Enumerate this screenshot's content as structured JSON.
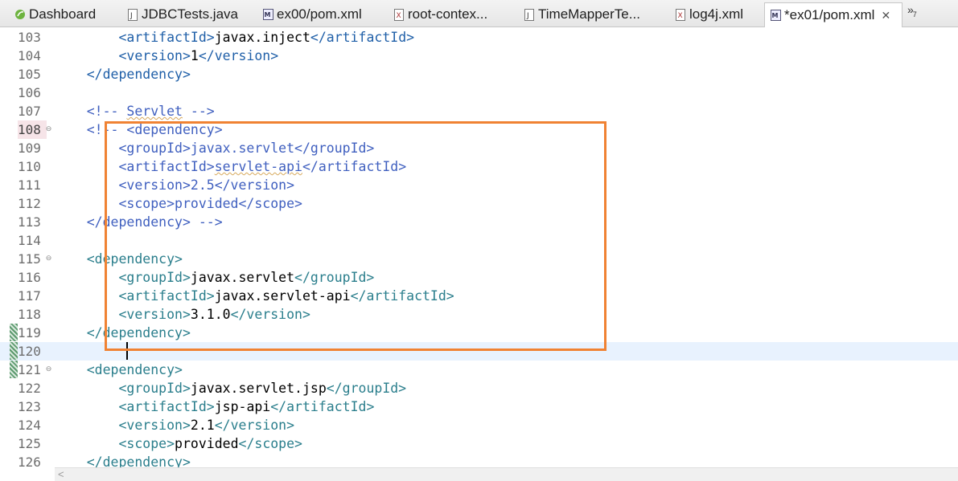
{
  "tabs": [
    {
      "label": "Dashboard",
      "icon": "spring-icon"
    },
    {
      "label": "JDBCTests.java",
      "icon": "java-file-icon"
    },
    {
      "label": "ex00/pom.xml",
      "icon": "maven-pom-icon"
    },
    {
      "label": "root-contex...",
      "icon": "xml-file-icon"
    },
    {
      "label": "TimeMapperTe...",
      "icon": "java-file-icon"
    },
    {
      "label": "log4j.xml",
      "icon": "xml-file-icon"
    },
    {
      "label": "*ex01/pom.xml",
      "icon": "maven-pom-icon",
      "active": true,
      "close": "✕"
    }
  ],
  "overflow": {
    "label": "»",
    "count": "7"
  },
  "editor": {
    "lines": [
      {
        "n": "103",
        "tokens": [
          [
            "        ",
            ""
          ],
          [
            "<artifactId>",
            "tag"
          ],
          [
            "javax.inject",
            "txt"
          ],
          [
            "</artifactId>",
            "tag"
          ]
        ]
      },
      {
        "n": "104",
        "tokens": [
          [
            "        ",
            ""
          ],
          [
            "<version>",
            "tag"
          ],
          [
            "1",
            "txt"
          ],
          [
            "</version>",
            "tag"
          ]
        ]
      },
      {
        "n": "105",
        "tokens": [
          [
            "    ",
            ""
          ],
          [
            "</dependency>",
            "tag"
          ]
        ]
      },
      {
        "n": "106",
        "tokens": []
      },
      {
        "n": "107",
        "tokens": [
          [
            "    ",
            ""
          ],
          [
            "<!-- ",
            "cmt"
          ],
          [
            "Servlet",
            "cmt sq"
          ],
          [
            " -->",
            "cmt"
          ]
        ]
      },
      {
        "n": "108",
        "diff": true,
        "fold": true,
        "tokens": [
          [
            "    ",
            ""
          ],
          [
            "<!-- <dependency>",
            "cmt"
          ]
        ]
      },
      {
        "n": "109",
        "tokens": [
          [
            "        ",
            ""
          ],
          [
            "<groupId>javax.servlet</groupId>",
            "cmt"
          ]
        ]
      },
      {
        "n": "110",
        "tokens": [
          [
            "        ",
            ""
          ],
          [
            "<artifactId>",
            "cmt"
          ],
          [
            "servlet-api",
            "cmt sq"
          ],
          [
            "</artifactId>",
            "cmt"
          ]
        ]
      },
      {
        "n": "111",
        "tokens": [
          [
            "        ",
            ""
          ],
          [
            "<version>2.5</version>",
            "cmt"
          ]
        ]
      },
      {
        "n": "112",
        "tokens": [
          [
            "        ",
            ""
          ],
          [
            "<scope>provided</scope>",
            "cmt"
          ]
        ]
      },
      {
        "n": "113",
        "tokens": [
          [
            "    ",
            ""
          ],
          [
            "</dependency> -->",
            "cmt"
          ]
        ]
      },
      {
        "n": "114",
        "tokens": []
      },
      {
        "n": "115",
        "fold": true,
        "tokens": [
          [
            "    ",
            ""
          ],
          [
            "<dependency>",
            "tag2"
          ]
        ]
      },
      {
        "n": "116",
        "tokens": [
          [
            "        ",
            ""
          ],
          [
            "<groupId>",
            "tag2"
          ],
          [
            "javax.servlet",
            "txt"
          ],
          [
            "</groupId>",
            "tag2"
          ]
        ]
      },
      {
        "n": "117",
        "tokens": [
          [
            "        ",
            ""
          ],
          [
            "<artifactId>",
            "tag2"
          ],
          [
            "javax.servlet-api",
            "txt"
          ],
          [
            "</artifactId>",
            "tag2"
          ]
        ]
      },
      {
        "n": "118",
        "tokens": [
          [
            "        ",
            ""
          ],
          [
            "<version>",
            "tag2"
          ],
          [
            "3.1.0",
            "txt"
          ],
          [
            "</version>",
            "tag2"
          ]
        ]
      },
      {
        "n": "119",
        "qmark": true,
        "tokens": [
          [
            "    ",
            ""
          ],
          [
            "</dependency>",
            "tag2"
          ]
        ]
      },
      {
        "n": "120",
        "qmark": true,
        "current": true,
        "tokens": []
      },
      {
        "n": "121",
        "qmark": true,
        "fold": true,
        "tokens": [
          [
            "    ",
            ""
          ],
          [
            "<dependency>",
            "tag2"
          ]
        ]
      },
      {
        "n": "122",
        "tokens": [
          [
            "        ",
            ""
          ],
          [
            "<groupId>",
            "tag2"
          ],
          [
            "javax.servlet.jsp",
            "txt"
          ],
          [
            "</groupId>",
            "tag2"
          ]
        ]
      },
      {
        "n": "123",
        "tokens": [
          [
            "        ",
            ""
          ],
          [
            "<artifactId>",
            "tag2"
          ],
          [
            "jsp-api",
            "txt"
          ],
          [
            "</artifactId>",
            "tag2"
          ]
        ]
      },
      {
        "n": "124",
        "tokens": [
          [
            "        ",
            ""
          ],
          [
            "<version>",
            "tag2"
          ],
          [
            "2.1",
            "txt"
          ],
          [
            "</version>",
            "tag2"
          ]
        ]
      },
      {
        "n": "125",
        "tokens": [
          [
            "        ",
            ""
          ],
          [
            "<scope>",
            "tag2"
          ],
          [
            "provided",
            "txt"
          ],
          [
            "</scope>",
            "tag2"
          ]
        ]
      },
      {
        "n": "126",
        "tokens": [
          [
            "    ",
            ""
          ],
          [
            "</dependency>",
            "tag2"
          ]
        ]
      }
    ],
    "fold_glyph": "⊖",
    "scroll_left_glyph": "<"
  },
  "colors": {
    "highlight": "#f08233",
    "current_line": "#e8f2fe"
  }
}
